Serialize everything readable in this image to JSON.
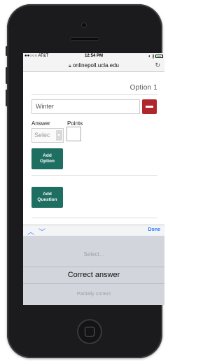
{
  "status_bar": {
    "carrier": "●●○○○ AT&T",
    "wifi_icon": "wifi-icon",
    "time": "12:54 PM",
    "indicators": "◐ ∦"
  },
  "url_bar": {
    "lock_icon": "lock-icon",
    "url": "onlinepoll.ucla.edu",
    "reload_icon": "reload-icon"
  },
  "option": {
    "title": "Option 1",
    "text_value": "Winter",
    "answer_label": "Answer",
    "points_label": "Points",
    "answer_select_value": "Selec",
    "points_value": "",
    "add_option_label": "Add Option",
    "add_question_label": "Add Question"
  },
  "toolbar": {
    "up_glyph": "︿",
    "down_glyph": "﹀",
    "done_label": "Done"
  },
  "picker": {
    "options": [
      "Select...",
      "Correct answer",
      "Partially correct"
    ],
    "selected": "Correct answer"
  },
  "colors": {
    "accent_teal": "#1e6e61",
    "remove_red": "#b0272b",
    "ios_blue": "#2f7bf6"
  }
}
